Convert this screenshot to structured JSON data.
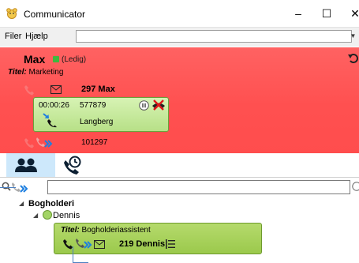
{
  "window": {
    "title": "Communicator",
    "controls": [
      "minimize",
      "maximize",
      "close"
    ]
  },
  "menu": {
    "items": [
      "Filer",
      "Hjælp"
    ],
    "input_value": ""
  },
  "status_panel": {
    "user_name": "Max",
    "status": "(Ledig)",
    "title_label": "Titel:",
    "title_value": "Marketing",
    "extension": "297 Max",
    "forward_number": "101297",
    "background_color": "#ff5252"
  },
  "active_call": {
    "duration": "00:00:26",
    "number": "577879",
    "name": "Langberg"
  },
  "tabs": [
    {
      "name": "contacts",
      "icon": "people-icon",
      "selected": true
    },
    {
      "name": "history",
      "icon": "phone-history-icon",
      "selected": false
    }
  ],
  "search": {
    "value": ""
  },
  "tree": {
    "group": "Bogholderi",
    "person": "Dennis",
    "card": {
      "title_label": "Titel:",
      "title_value": "Bogholderiassistent",
      "extension": "219 Dennis"
    }
  }
}
